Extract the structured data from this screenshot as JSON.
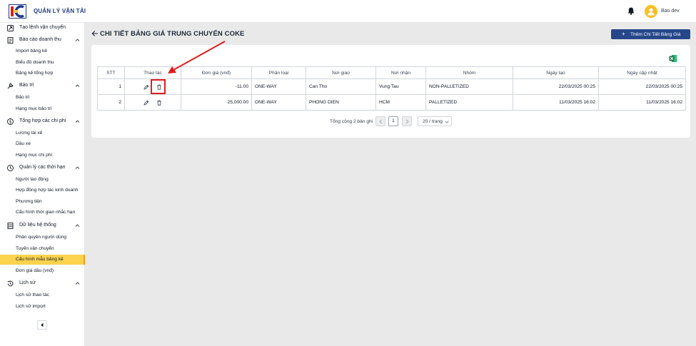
{
  "header": {
    "app_title": "QUẢN LÝ VẬN TẢI",
    "user_name": "Bao dev"
  },
  "sidebar": {
    "items": [
      {
        "type": "group",
        "label": "Tạo lệnh vận chuyển",
        "icon": "square-arrow-icon",
        "chevron": false
      },
      {
        "type": "group",
        "label": "Báo cáo doanh thu",
        "icon": "report-icon",
        "chevron": true
      },
      {
        "type": "item",
        "label": "Import bảng kê"
      },
      {
        "type": "item",
        "label": "Biểu đồ doanh thu"
      },
      {
        "type": "item",
        "label": "Bảng kê tổng hợp"
      },
      {
        "type": "group",
        "label": "Bảo trì",
        "icon": "wrench-icon",
        "chevron": true
      },
      {
        "type": "item",
        "label": "Bảo trì"
      },
      {
        "type": "item",
        "label": "Hạng mục bảo trì"
      },
      {
        "type": "group",
        "label": "Tổng hợp các chi phí",
        "icon": "dollar-circle-icon",
        "chevron": true
      },
      {
        "type": "item",
        "label": "Lương tài xế"
      },
      {
        "type": "item",
        "label": "Dầu xe"
      },
      {
        "type": "item",
        "label": "Hạng mục chi phí"
      },
      {
        "type": "group",
        "label": "Quản lý các thời hạn",
        "icon": "clock-icon",
        "chevron": true
      },
      {
        "type": "item",
        "label": "Người lao động"
      },
      {
        "type": "item",
        "label": "Hợp đồng hợp tác kinh doanh"
      },
      {
        "type": "item",
        "label": "Phương tiện"
      },
      {
        "type": "item",
        "label": "Cấu hình thời gian nhắc hạn"
      },
      {
        "type": "group",
        "label": "Dữ liệu hệ thống",
        "icon": "database-icon",
        "chevron": true
      },
      {
        "type": "item",
        "label": "Phân quyền người dùng"
      },
      {
        "type": "item",
        "label": "Tuyến vận chuyển"
      },
      {
        "type": "item",
        "label": "Cấu hình mẫu bảng kê",
        "active": true
      },
      {
        "type": "item",
        "label": "Đơn giá dầu (vnđ)"
      },
      {
        "type": "group",
        "label": "Lịch sử",
        "icon": "history-icon",
        "chevron": true
      },
      {
        "type": "item",
        "label": "Lịch sử thao tác"
      },
      {
        "type": "item",
        "label": "Lịch sử import"
      }
    ]
  },
  "main": {
    "title": "CHI TIẾT BẢNG GIÁ TRUNG CHUYỂN COKE",
    "add_button": "Thêm Chi Tiết Bảng Giá",
    "table": {
      "columns": [
        "STT",
        "Thao tác",
        "Đơn giá (vnđ)",
        "Phân loại",
        "Nơi giao",
        "Nơi nhận",
        "Nhóm",
        "Ngày tạo",
        "Ngày cập nhật"
      ],
      "rows": [
        {
          "stt": "1",
          "price": "-11.00",
          "type": "ONE-WAY",
          "from": "Can Tho",
          "to": "Vung Tau",
          "group": "NON-PALLETIZED",
          "created": "22/03/2025 00:25",
          "updated": "22/03/2025 00:25"
        },
        {
          "stt": "2",
          "price": "25,000.00",
          "type": "ONE-WAY",
          "from": "PHONG DIEN",
          "to": "HCM",
          "group": "PALLETIZED",
          "created": "11/03/2025 16:02",
          "updated": "11/03/2025 16:02"
        }
      ]
    },
    "pagination": {
      "total": "Tổng cộng 2 bản ghi",
      "current_page": "1",
      "page_size": "20 / trang"
    }
  },
  "colors": {
    "primary": "#27478a",
    "active_menu": "#fcd34d",
    "annotation": "#e11d1d",
    "excel": "#1d6f42"
  }
}
